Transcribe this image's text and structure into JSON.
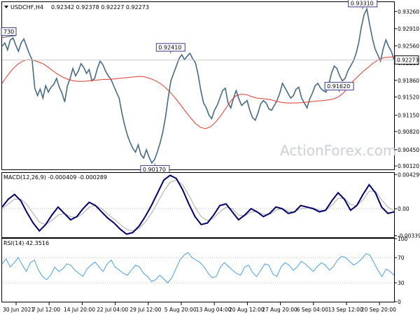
{
  "colors": {
    "price_line": "#476b85",
    "ma_line": "#e03b2f",
    "macd_line": "#00006e",
    "macd_signal": "#aaaaaa",
    "rsi_line": "#4a9fe3",
    "grid_dot": "#b8b8b8",
    "frame": "#000000"
  },
  "icons": {
    "dropdown": "triangle-down-icon"
  },
  "chart_data": [
    {
      "type": "line",
      "panel": "price",
      "header": {
        "symbol": "USDCHF,H4",
        "ohlc": "0.92342 0.92378 0.92227 0.92273"
      },
      "watermark": "ActionForex.com",
      "x_ticks": [
        "30 Jun 2021",
        "7 Jul 12:00",
        "14 Jul 20:00",
        "22 Jul 04:00",
        "29 Jul 12:00",
        "5 Aug 20:00",
        "13 Aug 04:00",
        "20 Aug 12:00",
        "27 Aug 20:00",
        "6 Sep 04:00",
        "13 Sep 12:00",
        "20 Sep 20:00"
      ],
      "y_ticks": [
        0.9012,
        0.9045,
        0.9082,
        0.9115,
        0.9152,
        0.9186,
        0.9221,
        0.9256,
        0.9291,
        0.9326
      ],
      "y_tick_labels": [
        "0.90120",
        "0.90450",
        "0.90820",
        "0.91150",
        "0.91520",
        "0.91860",
        "0.92210",
        "0.92560",
        "0.92910",
        "0.93260"
      ],
      "ylim": [
        0.9005,
        0.9345
      ],
      "current_price": 0.92273,
      "current_price_label": "0.92273",
      "annotations": [
        {
          "label": "730",
          "at": 0.0,
          "price": 0.9273
        },
        {
          "label": "0.92410",
          "at": 0.43,
          "price": 0.9241
        },
        {
          "label": "0.90170",
          "at": 0.39,
          "price": 0.9017
        },
        {
          "label": "0.93310",
          "at": 0.92,
          "price": 0.9331
        },
        {
          "label": "0.91620",
          "at": 0.86,
          "price": 0.9162
        }
      ],
      "series": [
        {
          "kind": "price",
          "values": [
            0.9255,
            0.9262,
            0.9248,
            0.9268,
            0.9272,
            0.9258,
            0.9245,
            0.9262,
            0.927,
            0.9255,
            0.924,
            0.9228,
            0.917,
            0.9155,
            0.9168,
            0.915,
            0.9175,
            0.9162,
            0.9172,
            0.9178,
            0.919,
            0.9172,
            0.916,
            0.9142,
            0.9175,
            0.919,
            0.921,
            0.9195,
            0.9205,
            0.922,
            0.9212,
            0.92,
            0.9208,
            0.9185,
            0.919,
            0.921,
            0.9225,
            0.9218,
            0.9205,
            0.9195,
            0.9188,
            0.9175,
            0.9162,
            0.915,
            0.912,
            0.9095,
            0.9075,
            0.906,
            0.9048,
            0.904,
            0.9055,
            0.9035,
            0.9028,
            0.9045,
            0.903,
            0.9018,
            0.9025,
            0.904,
            0.9058,
            0.908,
            0.911,
            0.915,
            0.9185,
            0.92,
            0.9215,
            0.923,
            0.9238,
            0.9228,
            0.9235,
            0.9241,
            0.923,
            0.9222,
            0.9198,
            0.9165,
            0.914,
            0.913,
            0.9115,
            0.9108,
            0.9125,
            0.9135,
            0.915,
            0.9165,
            0.917,
            0.914,
            0.913,
            0.915,
            0.9165,
            0.9148,
            0.9135,
            0.914,
            0.9145,
            0.9125,
            0.911,
            0.9105,
            0.912,
            0.9138,
            0.9145,
            0.914,
            0.9128,
            0.9125,
            0.9135,
            0.9145,
            0.916,
            0.918,
            0.917,
            0.916,
            0.915,
            0.9155,
            0.9168,
            0.9172,
            0.915,
            0.914,
            0.913,
            0.9148,
            0.916,
            0.9175,
            0.918,
            0.917,
            0.9165,
            0.9162,
            0.9178,
            0.92,
            0.9215,
            0.921,
            0.9195,
            0.9185,
            0.919,
            0.9205,
            0.9215,
            0.9225,
            0.924,
            0.9262,
            0.9295,
            0.932,
            0.9331,
            0.93,
            0.9272,
            0.925,
            0.9238,
            0.9225,
            0.925,
            0.9268,
            0.9255,
            0.9245,
            0.9227
          ]
        },
        {
          "kind": "moving_average",
          "values": [
            0.918,
            0.9195,
            0.9208,
            0.9218,
            0.9225,
            0.9228,
            0.9227,
            0.9224,
            0.922,
            0.9213,
            0.9205,
            0.9198,
            0.9192,
            0.9188,
            0.9185,
            0.9184,
            0.9184,
            0.9185,
            0.9186,
            0.9187,
            0.9188,
            0.9188,
            0.9189,
            0.919,
            0.9191,
            0.9192,
            0.9193,
            0.9194,
            0.9193,
            0.919,
            0.9186,
            0.918,
            0.9172,
            0.9162,
            0.915,
            0.9137,
            0.9123,
            0.911,
            0.9098,
            0.909,
            0.9088,
            0.9092,
            0.9102,
            0.9115,
            0.913,
            0.9145,
            0.9155,
            0.9158,
            0.9157,
            0.9153,
            0.915,
            0.9149,
            0.9148,
            0.9146,
            0.9143,
            0.9141,
            0.914,
            0.914,
            0.914,
            0.9141,
            0.9142,
            0.9143,
            0.9144,
            0.9145,
            0.9146,
            0.9148,
            0.9152,
            0.916,
            0.9172,
            0.9185,
            0.9195,
            0.9205,
            0.9213,
            0.9222,
            0.9228,
            0.9232,
            0.9233,
            0.9234
          ]
        }
      ]
    },
    {
      "type": "line",
      "panel": "macd",
      "header": {
        "title": "MACD(12,26,9) -0.000409 -0.000289"
      },
      "y_tick_labels": [
        "0.004299",
        "0.00",
        "-0.003396"
      ],
      "ylim": [
        -0.0036,
        0.0045
      ],
      "series": [
        {
          "kind": "macd",
          "values": [
            0.0002,
            0.0012,
            0.0018,
            0.001,
            -0.0005,
            -0.0018,
            -0.0028,
            -0.002,
            -0.0008,
            0.0002,
            -0.0006,
            -0.0014,
            -0.001,
            0.0,
            0.0008,
            0.0004,
            -0.0004,
            -0.0012,
            -0.0018,
            -0.0026,
            -0.0032,
            -0.003,
            -0.0022,
            -0.001,
            0.0004,
            0.002,
            0.0036,
            0.0042,
            0.0038,
            0.0024,
            0.0006,
            -0.001,
            -0.002,
            -0.0018,
            -0.0008,
            0.0004,
            0.0006,
            -0.0004,
            -0.0014,
            -0.0008,
            0.0,
            -0.0004,
            -0.001,
            -0.0006,
            0.0002,
            0.0,
            -0.0006,
            -0.0004,
            0.0004,
            0.0002,
            0.0,
            -0.0004,
            -0.0002,
            0.001,
            0.002,
            0.0012,
            -0.0002,
            0.0004,
            0.0018,
            0.003,
            0.002,
            0.0002,
            -0.0006,
            -0.0004
          ]
        },
        {
          "kind": "signal",
          "values": [
            0.0,
            0.0006,
            0.0012,
            0.0012,
            0.0005,
            -0.0006,
            -0.0017,
            -0.002,
            -0.0015,
            -0.0008,
            -0.0006,
            -0.001,
            -0.0011,
            -0.0006,
            0.0002,
            0.0004,
            0.0,
            -0.0007,
            -0.0013,
            -0.002,
            -0.0026,
            -0.0028,
            -0.0025,
            -0.0017,
            -0.0006,
            0.0008,
            0.0022,
            0.0033,
            0.0036,
            0.003,
            0.0017,
            0.0002,
            -0.001,
            -0.0015,
            -0.0012,
            -0.0004,
            0.0002,
            0.0,
            -0.0008,
            -0.0009,
            -0.0004,
            -0.0004,
            -0.0007,
            -0.0007,
            -0.0002,
            0.0,
            -0.0003,
            -0.0004,
            0.0,
            0.0001,
            0.0001,
            -0.0002,
            -0.0002,
            0.0004,
            0.0013,
            0.0013,
            0.0005,
            0.0004,
            0.0011,
            0.0022,
            0.0022,
            0.0011,
            0.0002,
            -0.0003
          ]
        }
      ]
    },
    {
      "type": "line",
      "panel": "rsi",
      "header": {
        "title": "RSI(14) 42.3516"
      },
      "y_ticks": [
        100,
        70,
        30,
        0
      ],
      "y_tick_labels": [
        "100",
        "70",
        "30",
        "0"
      ],
      "ylim": [
        0,
        100
      ],
      "series": [
        {
          "kind": "rsi",
          "values": [
            60,
            68,
            55,
            62,
            70,
            58,
            48,
            62,
            66,
            50,
            40,
            35,
            42,
            55,
            48,
            52,
            60,
            58,
            50,
            45,
            40,
            52,
            58,
            63,
            55,
            48,
            60,
            66,
            55,
            50,
            45,
            42,
            50,
            58,
            55,
            45,
            40,
            32,
            35,
            42,
            36,
            30,
            38,
            52,
            66,
            74,
            78,
            70,
            66,
            62,
            55,
            45,
            38,
            40,
            55,
            62,
            56,
            50,
            45,
            42,
            55,
            58,
            46,
            40,
            50,
            60,
            58,
            44,
            40,
            55,
            62,
            58,
            50,
            55,
            64,
            60,
            54,
            48,
            56,
            62,
            58,
            50,
            56,
            66,
            72,
            70,
            64,
            58,
            62,
            68,
            76,
            74,
            62,
            50,
            40,
            52,
            48,
            42
          ]
        }
      ]
    }
  ]
}
